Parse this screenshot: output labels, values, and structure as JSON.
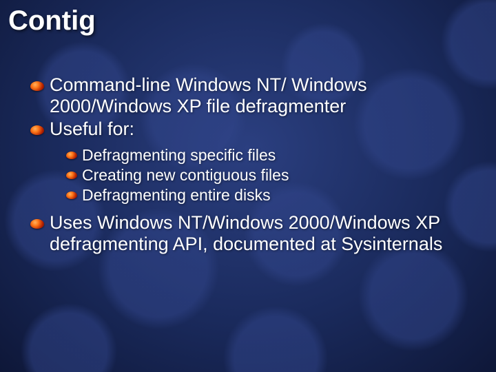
{
  "title": "Contig",
  "bullets": [
    {
      "text": "Command-line Windows NT/ Windows 2000/Windows XP file defragmenter"
    },
    {
      "text": "Useful for:"
    }
  ],
  "subbullets": [
    {
      "text": "Defragmenting specific files"
    },
    {
      "text": "Creating new contiguous files"
    },
    {
      "text": "Defragmenting entire disks"
    }
  ],
  "bullets2": [
    {
      "text": "Uses Windows NT/Windows 2000/Windows XP defragmenting API, documented at Sysinternals"
    }
  ]
}
